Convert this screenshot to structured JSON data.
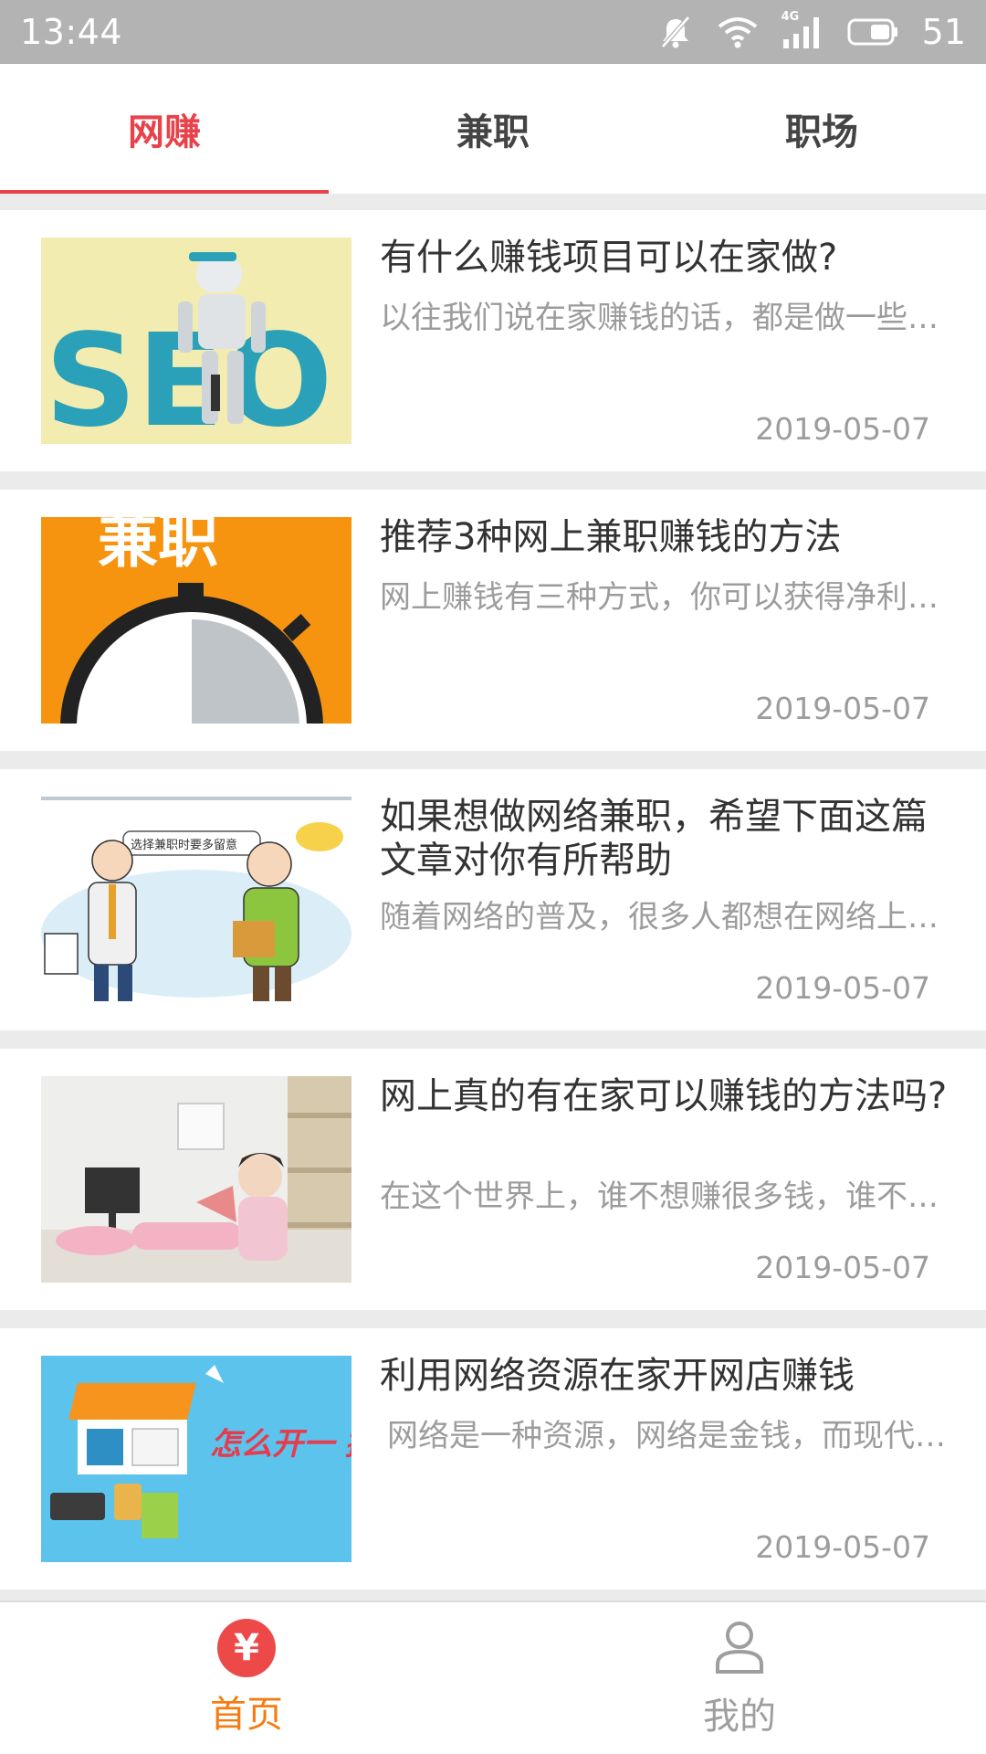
{
  "status_bar": {
    "time": "13:44",
    "network": "4G",
    "battery": "51",
    "icons": [
      "mute-bell-icon",
      "wifi-icon",
      "signal-icon",
      "battery-icon"
    ]
  },
  "tabs": [
    {
      "label": "网赚",
      "active": true
    },
    {
      "label": "兼职",
      "active": false
    },
    {
      "label": "职场",
      "active": false
    }
  ],
  "articles": [
    {
      "title": "有什么赚钱项目可以在家做?",
      "summary": "以往我们说在家赚钱的话，都是做一些…",
      "date": "2019-05-07",
      "thumb_text": "SEO"
    },
    {
      "title": "推荐3种网上兼职赚钱的方法",
      "summary": "网上赚钱有三种方式，你可以获得净利…",
      "date": "2019-05-07",
      "thumb_text": "兼职"
    },
    {
      "title": "如果想做网络兼职，希望下面这篇文章对你有所帮助",
      "summary": "随着网络的普及，很多人都想在网络上…",
      "date": "2019-05-07",
      "thumb_text": "选择兼职时要多留意"
    },
    {
      "title": "网上真的有在家可以赚钱的方法吗?",
      "summary": "在这个世界上，谁不想赚很多钱，谁不…",
      "date": "2019-05-07",
      "thumb_text": ""
    },
    {
      "title": "利用网络资源在家开网店赚钱",
      "summary": "网络是一种资源，网络是金钱，而现代…",
      "date": "2019-05-07",
      "thumb_text": "怎么开一 挣钱的网"
    }
  ],
  "bottom_nav": [
    {
      "label": "首页",
      "icon": "yuan-icon",
      "icon_glyph": "¥",
      "active": true
    },
    {
      "label": "我的",
      "icon": "user-icon",
      "active": false
    }
  ],
  "colors": {
    "accent_red": "#e8424a",
    "active_nav_orange": "#f47c12",
    "status_bar": "#b3b3b3",
    "divider": "#ebebeb"
  }
}
